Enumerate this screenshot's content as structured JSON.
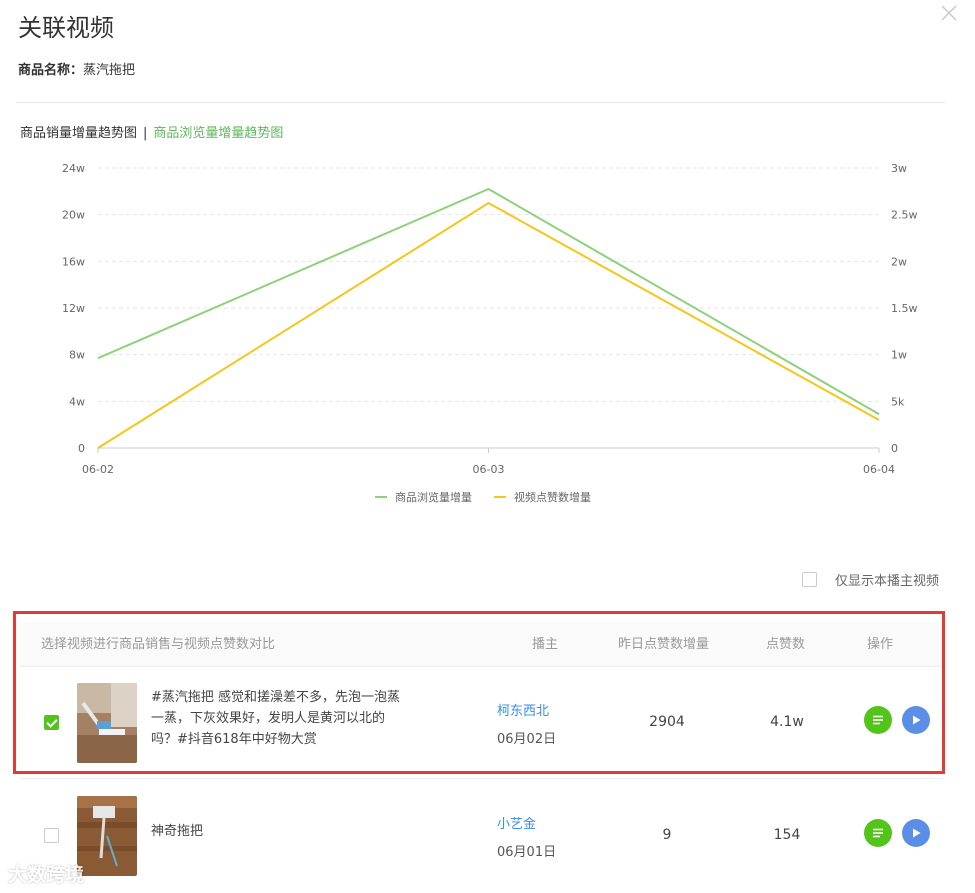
{
  "dialog": {
    "title": "关联视频",
    "product_label": "商品名称：",
    "product_name": "蒸汽拖把"
  },
  "tabs": {
    "sales_tab": "商品销量增量趋势图",
    "separator": "|",
    "views_tab": "商品浏览量增量趋势图"
  },
  "chart_data": {
    "type": "line",
    "x": [
      "06-02",
      "06-03",
      "06-04"
    ],
    "left_axis_ticks": [
      "0",
      "4w",
      "8w",
      "12w",
      "16w",
      "20w",
      "24w"
    ],
    "right_axis_ticks": [
      "0",
      "5k",
      "1w",
      "1.5w",
      "2w",
      "2.5w",
      "3w"
    ],
    "left_ylim": [
      0,
      240000
    ],
    "right_ylim": [
      0,
      30000
    ],
    "series": [
      {
        "name": "商品浏览量增量",
        "axis": "left",
        "color": "#8ed17a",
        "values": [
          77000,
          222000,
          29000
        ]
      },
      {
        "name": "视频点赞数增量",
        "axis": "right",
        "color": "#f5c518",
        "values": [
          0,
          26250,
          3000
        ]
      }
    ],
    "legend_position": "bottom-center",
    "grid": true
  },
  "filter": {
    "only_this_host_label": "仅显示本播主视频",
    "only_this_host_checked": false
  },
  "table": {
    "headers": {
      "select": "选择视频进行商品销售与视频点赞数对比",
      "host": "播主",
      "likes_delta": "昨日点赞数增量",
      "likes": "点赞数",
      "actions": "操作"
    },
    "rows": [
      {
        "checked": true,
        "desc": "#蒸汽拖把 感觉和搓澡差不多，先泡一泡蒸一蒸，下灰效果好，发明人是黄河以北的吗？#抖音618年中好物大赏",
        "host": "柯东西北",
        "date": "06月02日",
        "likes_delta": "2904",
        "likes": "4.1w"
      },
      {
        "checked": false,
        "desc": "神奇拖把",
        "host": "小艺金",
        "date": "06月01日",
        "likes_delta": "9",
        "likes": "154"
      }
    ]
  },
  "watermark": "大数跨境"
}
